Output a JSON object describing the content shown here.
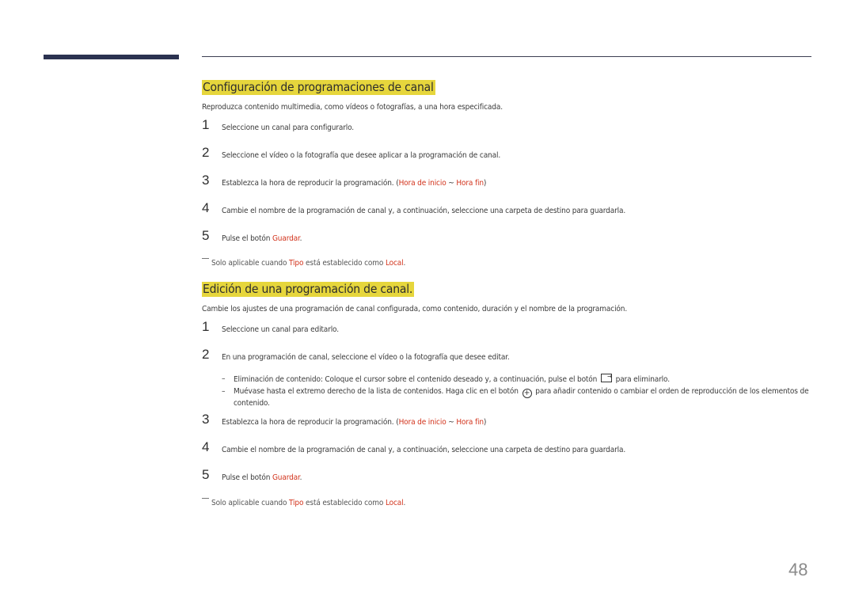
{
  "page_number": "48",
  "section1": {
    "title": "Configuración de programaciones de canal",
    "intro": "Reproduzca contenido multimedia, como vídeos o fotografías, a una hora especificada.",
    "steps": [
      {
        "num": "1",
        "text": "Seleccione un canal para configurarlo."
      },
      {
        "num": "2",
        "text": "Seleccione el vídeo o la fotografía que desee aplicar a la programación de canal."
      },
      {
        "num": "3",
        "pre": "Establezca la hora de reproducir la programación. (",
        "hl1": "Hora de inicio",
        "mid": " ~ ",
        "hl2": "Hora fin",
        "post": ")"
      },
      {
        "num": "4",
        "text": "Cambie el nombre de la programación de canal y, a continuación, seleccione una carpeta de destino para guardarla."
      },
      {
        "num": "5",
        "pre": "Pulse el botón ",
        "hl1": "Guardar",
        "post": "."
      }
    ],
    "note": {
      "pre": "Solo aplicable cuando ",
      "hl1": "Tipo",
      "mid": " está establecido como ",
      "hl2": "Local",
      "post": "."
    }
  },
  "section2": {
    "title": "Edición de una programación de canal.",
    "intro": "Cambie los ajustes de una programación de canal configurada, como contenido, duración y el nombre de la programación.",
    "steps": [
      {
        "num": "1",
        "text": "Seleccione un canal para editarlo."
      },
      {
        "num": "2",
        "text": "En una programación de canal, seleccione el vídeo o la fotografía que desee editar."
      },
      {
        "num": "3",
        "pre": "Establezca la hora de reproducir la programación. (",
        "hl1": "Hora de inicio",
        "mid": " ~ ",
        "hl2": "Hora fin",
        "post": ")"
      },
      {
        "num": "4",
        "text": "Cambie el nombre de la programación de canal y, a continuación, seleccione una carpeta de destino para guardarla."
      },
      {
        "num": "5",
        "pre": "Pulse el botón ",
        "hl1": "Guardar",
        "post": "."
      }
    ],
    "subitems": [
      {
        "bullet": "–",
        "pre": "Eliminación de contenido: Coloque el cursor sobre el contenido deseado y, a continuación, pulse el botón ",
        "icon": "remove-content-icon",
        "post": " para eliminarlo."
      },
      {
        "bullet": "–",
        "pre": "Muévase hasta el extremo derecho de la lista de contenidos. Haga clic en el botón ",
        "icon": "add-circle-icon",
        "post": " para añadir contenido o cambiar el orden de reproducción de los elementos de contenido."
      }
    ],
    "note": {
      "pre": "Solo aplicable cuando ",
      "hl1": "Tipo",
      "mid": " está establecido como ",
      "hl2": "Local",
      "post": "."
    }
  }
}
